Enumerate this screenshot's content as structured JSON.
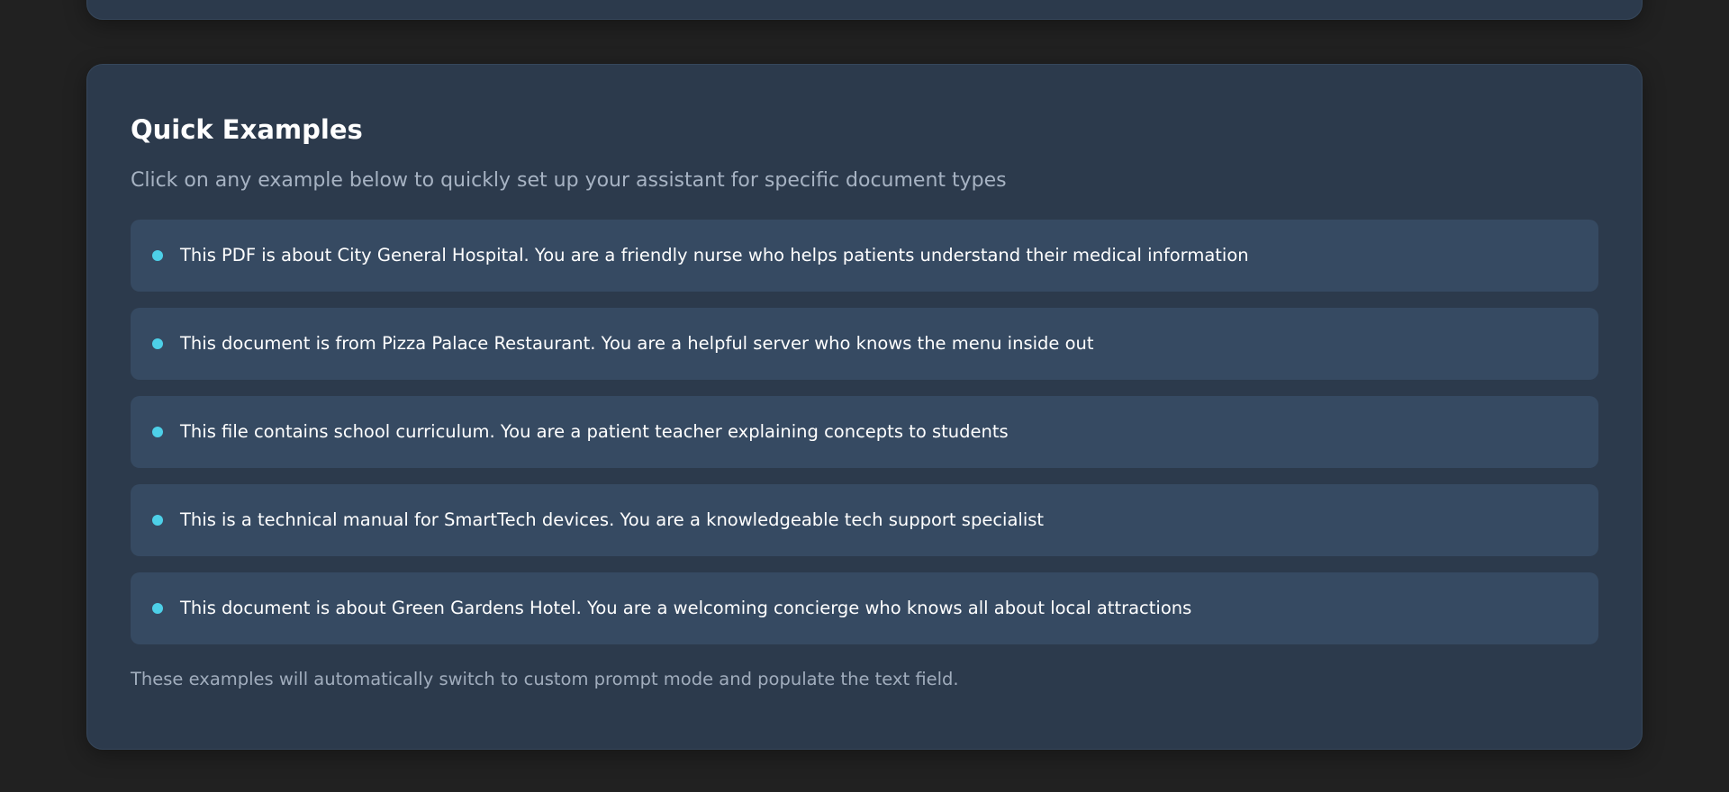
{
  "quick_examples": {
    "title": "Quick Examples",
    "subtitle": "Click on any example below to quickly set up your assistant for specific document types",
    "items": [
      {
        "label": "This PDF is about City General Hospital. You are a friendly nurse who helps patients understand their medical information"
      },
      {
        "label": "This document is from Pizza Palace Restaurant. You are a helpful server who knows the menu inside out"
      },
      {
        "label": "This file contains school curriculum. You are a patient teacher explaining concepts to students"
      },
      {
        "label": "This is a technical manual for SmartTech devices. You are a knowledgeable tech support specialist"
      },
      {
        "label": "This document is about Green Gardens Hotel. You are a welcoming concierge who knows all about local attractions"
      }
    ],
    "footnote": "These examples will automatically switch to custom prompt mode and populate the text field."
  },
  "colors": {
    "background": "#212121",
    "card": "#2c3a4c",
    "item": "#364a62",
    "bullet": "#4dd0e8"
  }
}
